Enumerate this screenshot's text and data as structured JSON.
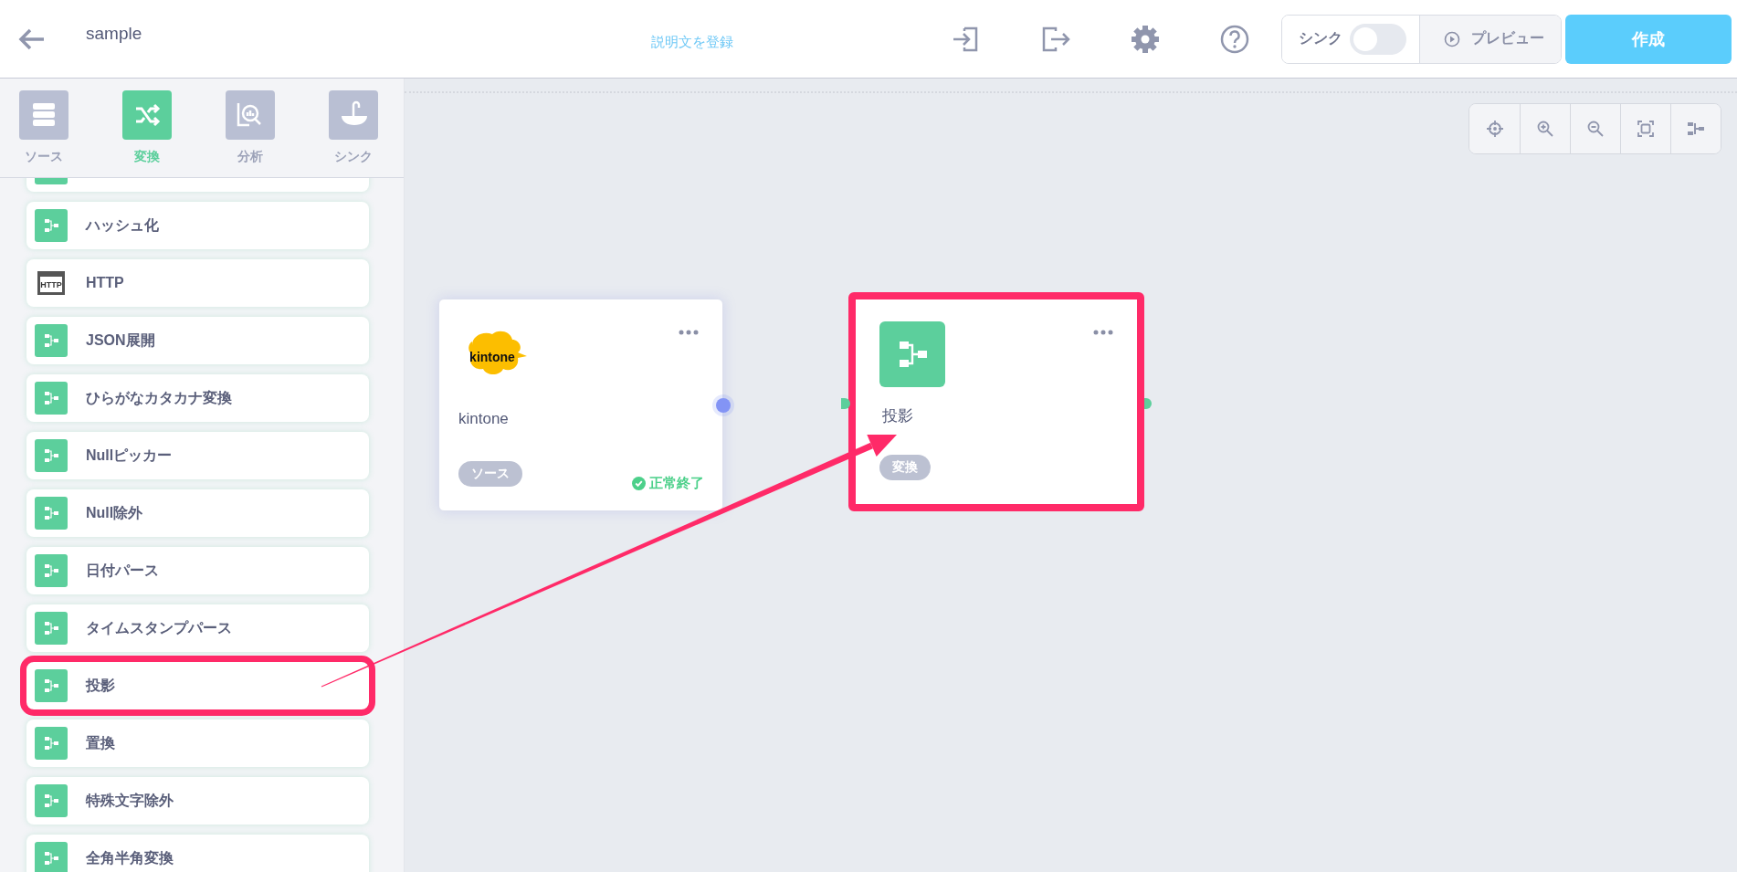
{
  "header": {
    "title": "sample",
    "description_link": "説明文を登録",
    "sync": {
      "label": "シンク",
      "on": false
    },
    "preview": "プレビュー",
    "create": "作成"
  },
  "sidebar": {
    "tabs": [
      {
        "label": "ソース",
        "kind": "source",
        "selected": false
      },
      {
        "label": "変換",
        "kind": "transform",
        "selected": true
      },
      {
        "label": "分析",
        "kind": "analysis",
        "selected": false
      },
      {
        "label": "シンク",
        "kind": "sink",
        "selected": false
      }
    ],
    "items": [
      {
        "label": "ハッシュ化",
        "kind": "transform",
        "highlighted": false
      },
      {
        "label": "HTTP",
        "kind": "http",
        "icon_text": "HTTP",
        "highlighted": false
      },
      {
        "label": "JSON展開",
        "kind": "transform",
        "highlighted": false
      },
      {
        "label": "ひらがなカタカナ変換",
        "kind": "transform",
        "highlighted": false
      },
      {
        "label": "Nullピッカー",
        "kind": "transform",
        "highlighted": false
      },
      {
        "label": "Null除外",
        "kind": "transform",
        "highlighted": false
      },
      {
        "label": "日付パース",
        "kind": "transform",
        "highlighted": false
      },
      {
        "label": "タイムスタンプパース",
        "kind": "transform",
        "highlighted": false
      },
      {
        "label": "投影",
        "kind": "transform",
        "highlighted": true
      },
      {
        "label": "置換",
        "kind": "transform",
        "highlighted": false
      },
      {
        "label": "特殊文字除外",
        "kind": "transform",
        "highlighted": false
      },
      {
        "label": "全角半角変換",
        "kind": "transform",
        "highlighted": false
      }
    ]
  },
  "canvas": {
    "nodes": [
      {
        "kind": "source",
        "logo_text": "kintone",
        "name": "kintone",
        "tag": "ソース",
        "status": "正常終了",
        "highlighted": false
      },
      {
        "kind": "transform",
        "name": "投影",
        "tag": "変換",
        "highlighted": true
      }
    ]
  }
}
